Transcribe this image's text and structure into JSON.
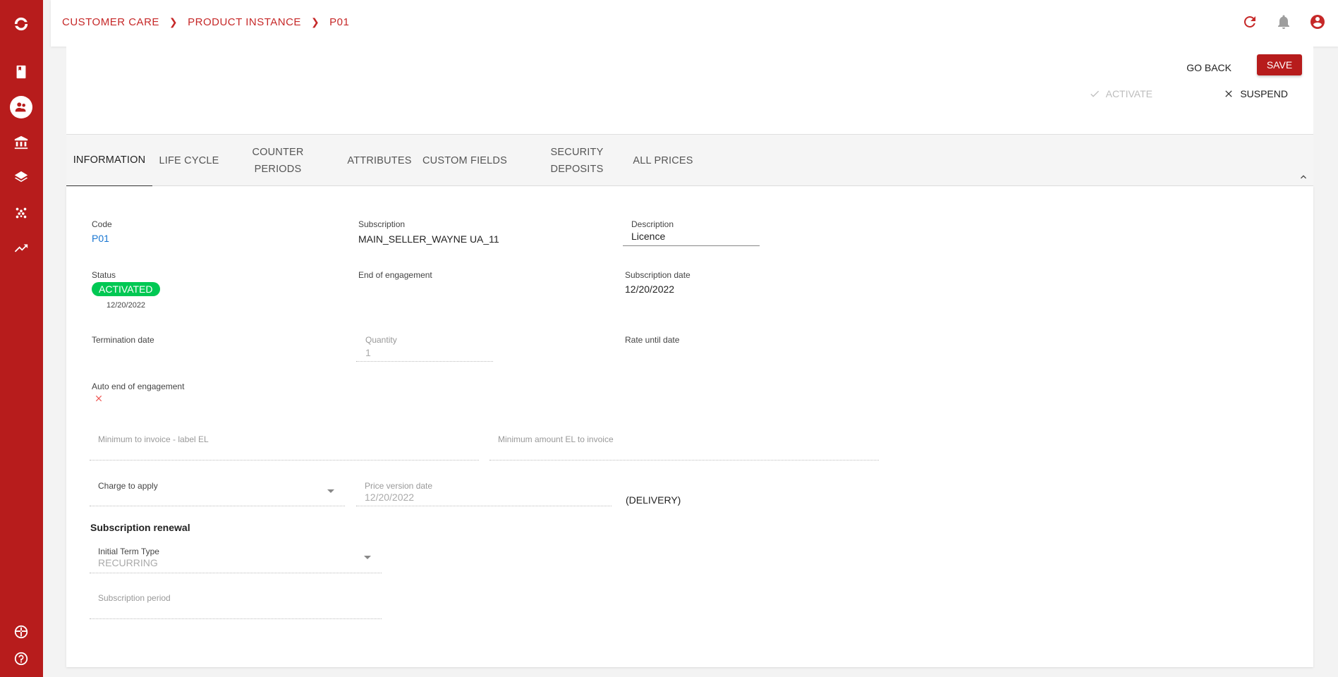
{
  "breadcrumb": [
    "CUSTOMER CARE",
    "PRODUCT INSTANCE",
    "P01"
  ],
  "colors": {
    "brand": "#b71c1c",
    "status_active": "#00c853",
    "link": "#1976d2"
  },
  "sidebar": {
    "icons": [
      "logo-icon",
      "book-icon",
      "customers-icon",
      "bank-icon",
      "layers-icon",
      "dots-icon",
      "trending-icon",
      "language-icon",
      "help-icon"
    ]
  },
  "header": {
    "go_back": "GO BACK",
    "save": "SAVE",
    "activate": "ACTIVATE",
    "suspend": "SUSPEND"
  },
  "tabs": [
    {
      "label": "INFORMATION",
      "active": true
    },
    {
      "label": "LIFE CYCLE"
    },
    {
      "label": "COUNTER PERIODS"
    },
    {
      "label": "ATTRIBUTES"
    },
    {
      "label": "CUSTOM FIELDS"
    },
    {
      "label": "SECURITY DEPOSITS"
    },
    {
      "label": "ALL PRICES"
    }
  ],
  "form": {
    "code": {
      "label": "Code",
      "value": "P01"
    },
    "subscription": {
      "label": "Subscription",
      "value": "MAIN_SELLER_WAYNE UA_11"
    },
    "description": {
      "label": "Description",
      "value": "Licence"
    },
    "status": {
      "label": "Status",
      "value": "ACTIVATED",
      "date": "12/20/2022"
    },
    "end_of_engagement": {
      "label": "End of engagement"
    },
    "subscription_date": {
      "label": "Subscription date",
      "value": "12/20/2022"
    },
    "termination_date": {
      "label": "Termination date"
    },
    "quantity": {
      "label": "Quantity",
      "value": "1"
    },
    "rate_until_date": {
      "label": "Rate until date"
    },
    "auto_end": {
      "label": "Auto end of engagement"
    },
    "min_invoice_label": {
      "placeholder": "Minimum to invoice - label EL"
    },
    "min_amount": {
      "placeholder": "Minimum amount EL to invoice"
    },
    "charge_to_apply": {
      "placeholder": "Charge to apply"
    },
    "price_version_date": {
      "label": "Price version date",
      "value": "12/20/2022"
    },
    "delivery": "(DELIVERY)",
    "renewal_title": "Subscription renewal",
    "initial_term_type": {
      "label": "Initial Term Type",
      "value": "RECURRING"
    },
    "subscription_period": {
      "placeholder": "Subscription period"
    }
  }
}
